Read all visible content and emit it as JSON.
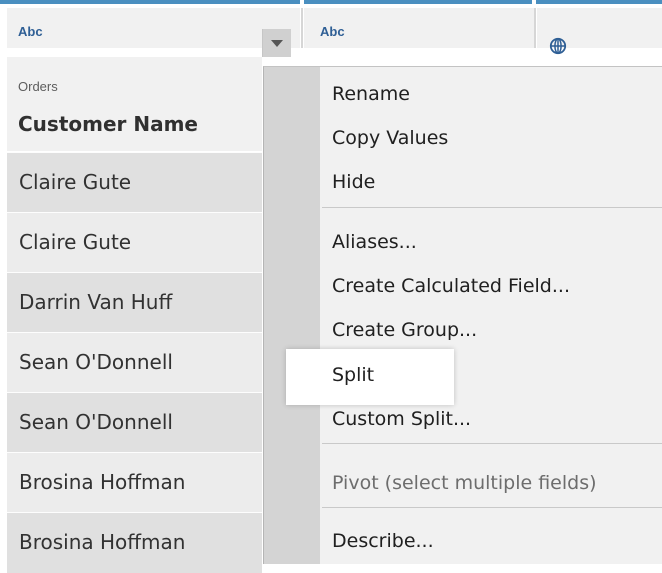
{
  "columns": [
    {
      "type_label": "Abc"
    },
    {
      "type_label": "Abc"
    }
  ],
  "field": {
    "source": "Orders",
    "name": "Customer Name"
  },
  "rows": [
    {
      "value": "Claire Gute"
    },
    {
      "value": "Claire Gute"
    },
    {
      "value": "Darrin Van Huff"
    },
    {
      "value": "Sean O'Donnell"
    },
    {
      "value": "Sean O'Donnell"
    },
    {
      "value": "Brosina Hoffman"
    },
    {
      "value": "Brosina Hoffman"
    }
  ],
  "menu": {
    "items": [
      {
        "label": "Rename"
      },
      {
        "label": "Copy Values"
      },
      {
        "label": "Hide"
      },
      {
        "label": "Aliases..."
      },
      {
        "label": "Create Calculated Field..."
      },
      {
        "label": "Create Group..."
      },
      {
        "label": "Split"
      },
      {
        "label": "Custom Split..."
      },
      {
        "label": "Pivot (select multiple fields)",
        "disabled": true
      },
      {
        "label": "Describe..."
      }
    ],
    "highlighted": "Split"
  },
  "icons": {
    "dropdown": "chevron-down-icon",
    "geo": "globe-icon"
  },
  "colors": {
    "accent": "#4a8fc0",
    "type_label": "#2f5f95"
  }
}
